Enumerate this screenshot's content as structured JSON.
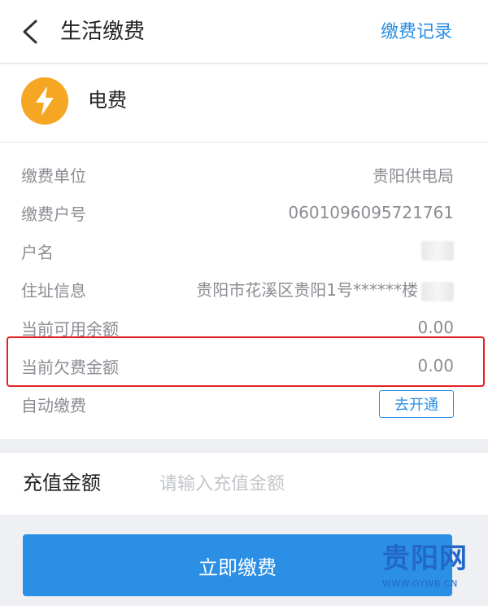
{
  "header": {
    "title": "生活缴费",
    "right_link": "缴费记录"
  },
  "bill": {
    "icon": "lightning-bolt-icon",
    "name": "电费",
    "icon_color": "#f5a623"
  },
  "details": [
    {
      "label": "缴费单位",
      "value": "贵阳供电局"
    },
    {
      "label": "缴费户号",
      "value": "0601096095721761"
    },
    {
      "label": "户名",
      "value": ""
    },
    {
      "label": "住址信息",
      "value": "贵阳市花溪区贵阳1号******楼"
    },
    {
      "label": "当前可用余额",
      "value": "0.00"
    },
    {
      "label": "当前欠费金额",
      "value": "0.00"
    },
    {
      "label": "自动缴费",
      "button": "去开通"
    }
  ],
  "recharge": {
    "label": "充值金额",
    "placeholder": "请输入充值金额"
  },
  "pay_button": "立即缴费",
  "watermark": {
    "logo": "贵阳网",
    "url": "WWW.GYWB.CN"
  },
  "colors": {
    "accent": "#2b8fe6",
    "highlight_border": "#e02222"
  }
}
